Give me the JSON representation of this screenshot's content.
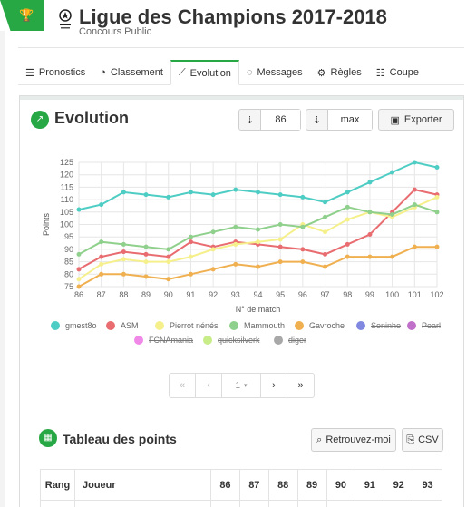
{
  "app": {
    "title": "Ligue des Champions 2017-2018",
    "subtitle": "Concours Public",
    "badge_icon": "trophy-icon",
    "accent_color": "#28a745"
  },
  "tabs": [
    {
      "label": "Pronostics",
      "icon": "sliders-icon",
      "active": false
    },
    {
      "label": "Classement",
      "icon": "dashboard-icon",
      "active": false
    },
    {
      "label": "Evolution",
      "icon": "line-chart-icon",
      "active": true
    },
    {
      "label": "Messages",
      "icon": "comments-icon",
      "active": false
    },
    {
      "label": "Règles",
      "icon": "cogs-icon",
      "active": false
    },
    {
      "label": "Coupe",
      "icon": "list-icon",
      "active": false
    }
  ],
  "evolution": {
    "title": "Evolution",
    "start_match": "86",
    "end_match": "max",
    "export_label": "Exporter"
  },
  "chart_data": {
    "type": "line",
    "xlabel": "N° de match",
    "ylabel": "Points",
    "ylim": [
      75,
      125
    ],
    "yticks": [
      75,
      80,
      85,
      90,
      95,
      100,
      105,
      110,
      115,
      120,
      125
    ],
    "x": [
      86,
      87,
      88,
      89,
      90,
      91,
      92,
      93,
      94,
      95,
      96,
      97,
      98,
      99,
      100,
      101,
      102
    ],
    "grid": true,
    "series": [
      {
        "name": "gmest8o",
        "color": "#4ecdc4",
        "values": [
          106,
          108,
          113,
          112,
          111,
          113,
          112,
          114,
          113,
          112,
          111,
          109,
          113,
          117,
          121,
          125,
          123
        ]
      },
      {
        "name": "ASM",
        "color": "#e86c70",
        "values": [
          82,
          87,
          89,
          88,
          87,
          93,
          91,
          93,
          92,
          91,
          90,
          88,
          92,
          96,
          105,
          114,
          112
        ]
      },
      {
        "name": "Pierrot nénés",
        "color": "#f5f08c",
        "values": [
          78,
          84,
          86,
          85,
          85,
          87,
          90,
          92,
          93,
          94,
          100,
          97,
          102,
          105,
          103,
          107,
          111
        ]
      },
      {
        "name": "Mammouth",
        "color": "#8fd08c",
        "values": [
          88,
          93,
          92,
          91,
          90,
          95,
          97,
          99,
          98,
          100,
          99,
          103,
          107,
          105,
          104,
          108,
          105
        ]
      },
      {
        "name": "Gavroche",
        "color": "#f0b050",
        "values": [
          75,
          80,
          80,
          79,
          78,
          80,
          82,
          84,
          83,
          85,
          85,
          83,
          87,
          87,
          87,
          91,
          91
        ]
      }
    ],
    "hidden_series": [
      {
        "name": "Soninho",
        "color": "#8088e0"
      },
      {
        "name": "Pearl",
        "color": "#c070c8"
      },
      {
        "name": "FCNAmania",
        "color": "#f088e8"
      },
      {
        "name": "quicksilverk",
        "color": "#c8ec88"
      },
      {
        "name": "diger",
        "color": "#a8a8a8"
      }
    ]
  },
  "pager": {
    "first": "«",
    "prev": "‹",
    "current": "1",
    "next": "›",
    "last": "»"
  },
  "points_table": {
    "title": "Tableau des points",
    "retrouvez_label": "Retrouvez-moi",
    "csv_label": "CSV",
    "headers": [
      "Rang",
      "Joueur",
      "86",
      "87",
      "88",
      "89",
      "90",
      "91",
      "92",
      "93"
    ]
  }
}
